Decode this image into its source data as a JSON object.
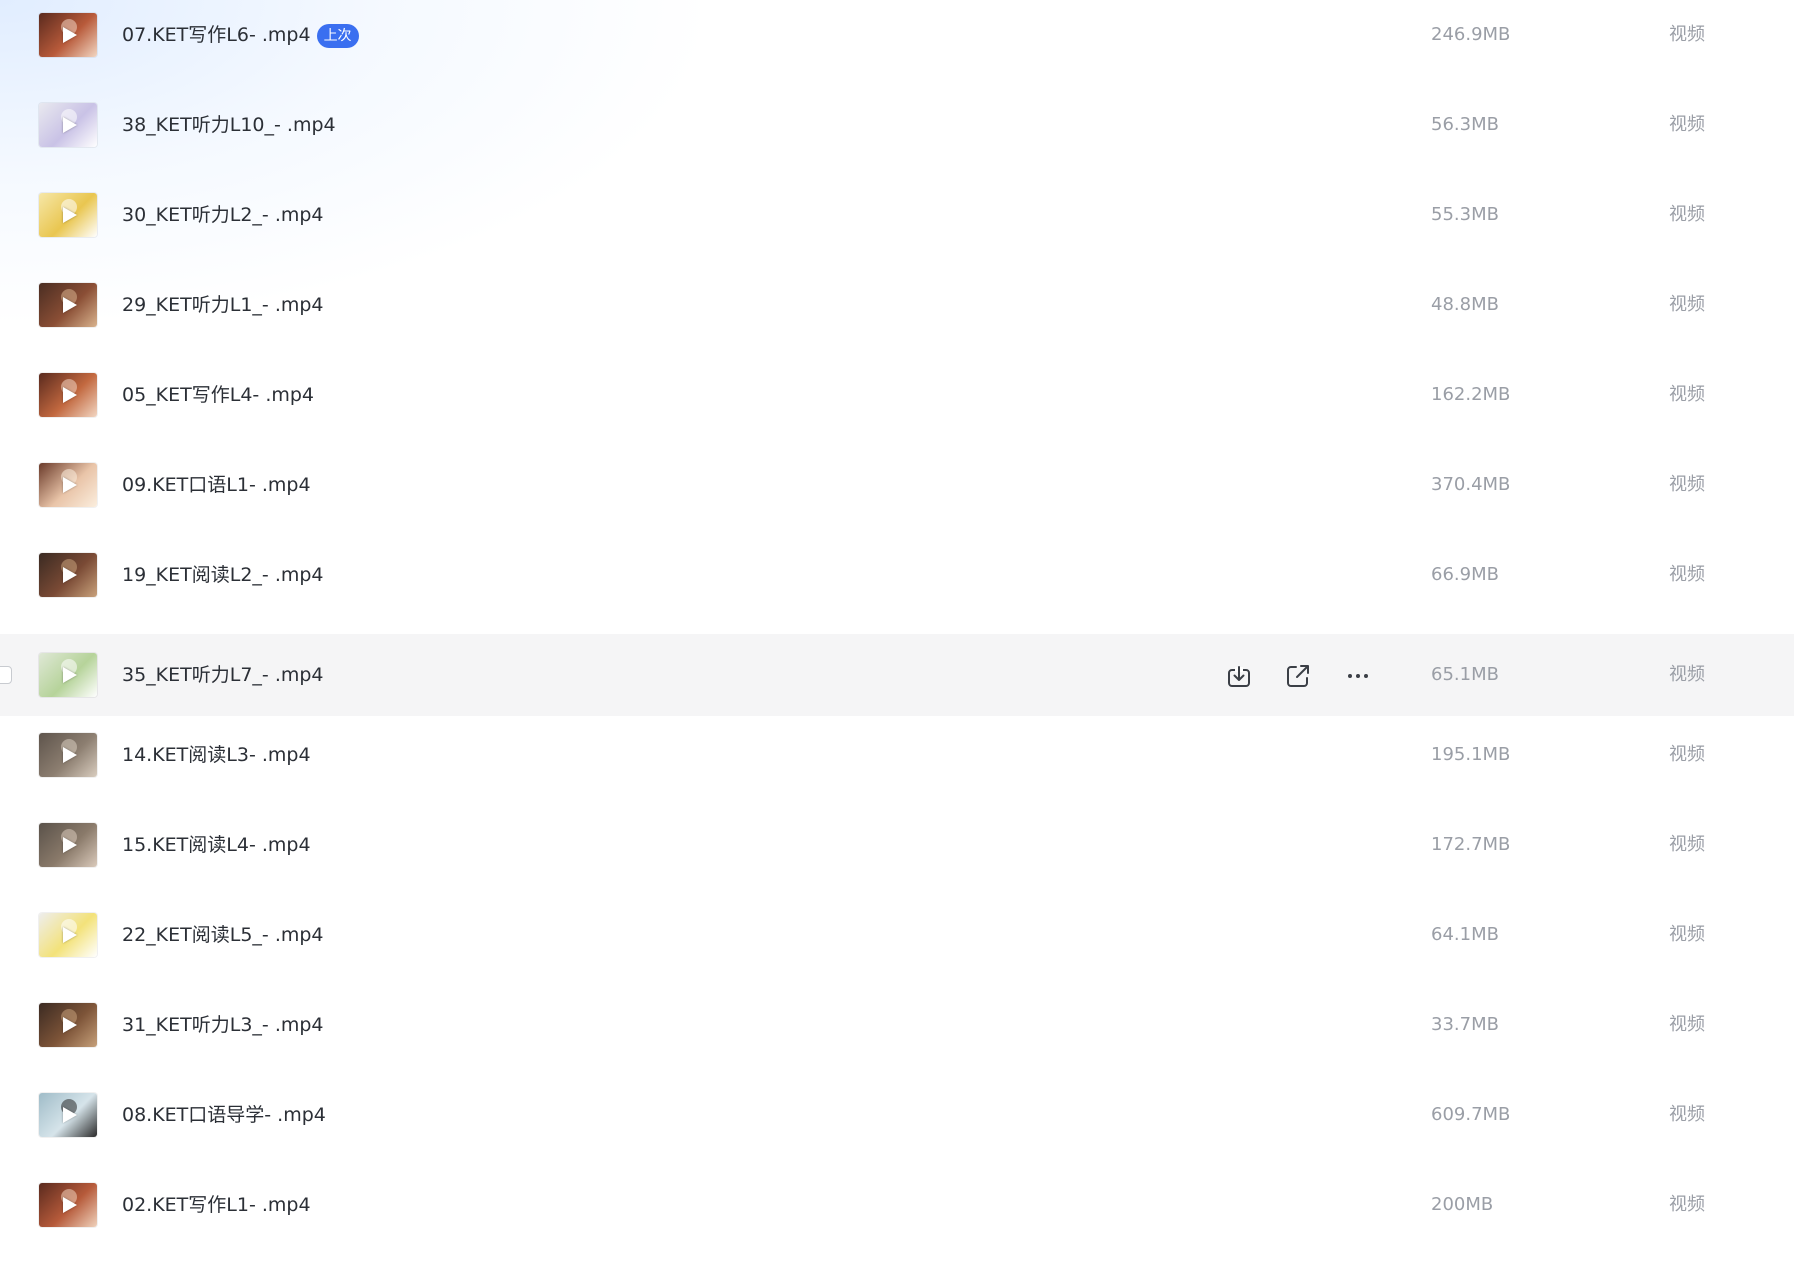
{
  "files": [
    {
      "name": "07.KET写作L6- .mp4",
      "size": "246.9MB",
      "type": "视频",
      "badge": "上次",
      "thumb": [
        "#5a2a1e",
        "#b85a3a",
        "#f2d6c2"
      ]
    },
    {
      "name": "38_KET听力L10_- .mp4",
      "size": "56.3MB",
      "type": "视频",
      "thumb": [
        "#e9e9ef",
        "#c9c2e6",
        "#ffffff"
      ]
    },
    {
      "name": "30_KET听力L2_- .mp4",
      "size": "55.3MB",
      "type": "视频",
      "thumb": [
        "#f6e7a8",
        "#e9c650",
        "#ffffff"
      ]
    },
    {
      "name": "29_KET听力L1_- .mp4",
      "size": "48.8MB",
      "type": "视频",
      "thumb": [
        "#4a2d22",
        "#8a4e35",
        "#d9b38e"
      ]
    },
    {
      "name": "05_KET写作L4- .mp4",
      "size": "162.2MB",
      "type": "视频",
      "thumb": [
        "#5a2a1e",
        "#c2683f",
        "#f2d6c2"
      ]
    },
    {
      "name": "09.KET口语L1- .mp4",
      "size": "370.4MB",
      "type": "视频",
      "thumb": [
        "#6a3a2a",
        "#e9c4a8",
        "#fbeede"
      ]
    },
    {
      "name": "19_KET阅读L2_- .mp4",
      "size": "66.9MB",
      "type": "视频",
      "thumb": [
        "#3a2a22",
        "#7a4a35",
        "#c9a27c"
      ]
    },
    {
      "name": "35_KET听力L7_- .mp4",
      "size": "65.1MB",
      "type": "视频",
      "hovered": true,
      "thumb": [
        "#dfe8d6",
        "#b6d39a",
        "#ffffff"
      ]
    },
    {
      "name": "14.KET阅读L3- .mp4",
      "size": "195.1MB",
      "type": "视频",
      "thumb": [
        "#5e544c",
        "#8c7e70",
        "#d9cdbf"
      ]
    },
    {
      "name": "15.KET阅读L4- .mp4",
      "size": "172.7MB",
      "type": "视频",
      "thumb": [
        "#5a524a",
        "#8a7a6a",
        "#dacabb"
      ]
    },
    {
      "name": "22_KET阅读L5_- .mp4",
      "size": "64.1MB",
      "type": "视频",
      "thumb": [
        "#eeeeee",
        "#f3e27a",
        "#ffffff"
      ]
    },
    {
      "name": "31_KET听力L3_- .mp4",
      "size": "33.7MB",
      "type": "视频",
      "thumb": [
        "#3b2a22",
        "#7d5438",
        "#c6a07a"
      ]
    },
    {
      "name": "08.KET口语导学- .mp4",
      "size": "609.7MB",
      "type": "视频",
      "thumb": [
        "#9fbcc8",
        "#d6e4ea",
        "#2a2a2a"
      ]
    },
    {
      "name": "02.KET写作L1- .mp4",
      "size": "200MB",
      "type": "视频",
      "thumb": [
        "#5a2a1e",
        "#b65a3a",
        "#f0d2bc"
      ]
    }
  ],
  "row_actions": {
    "download": "download-icon",
    "share": "share-icon",
    "more": "more-icon"
  }
}
